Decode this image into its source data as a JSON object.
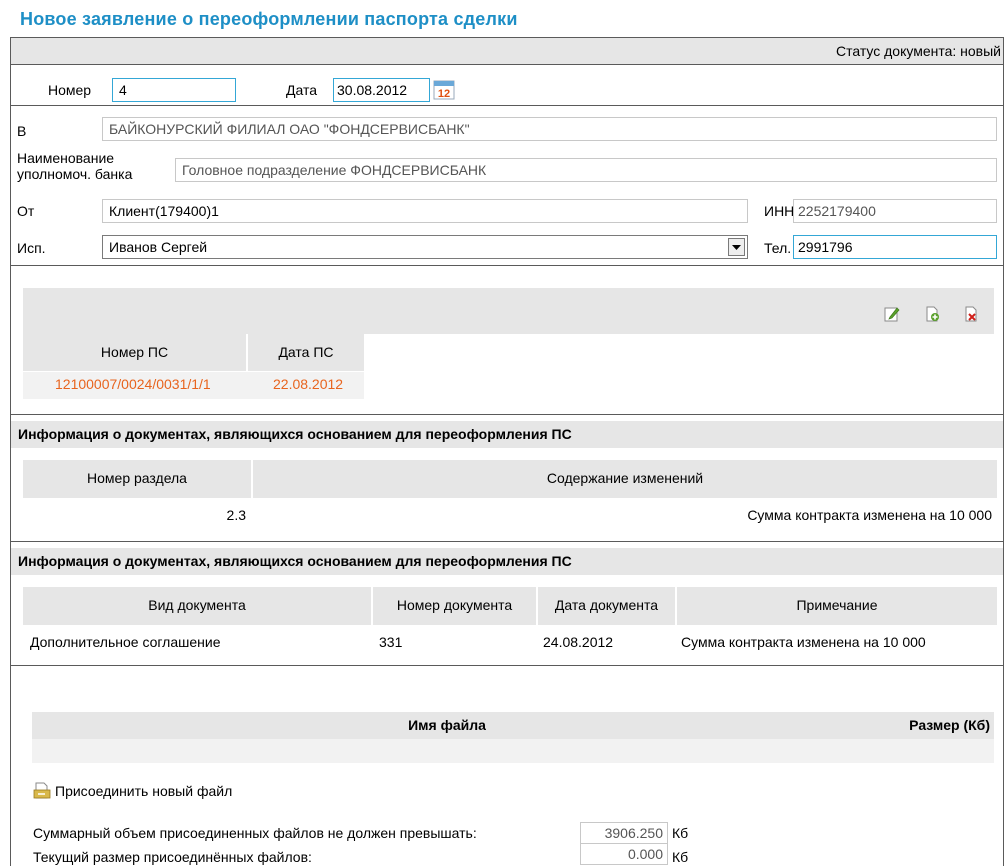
{
  "page": {
    "title": "Новое заявление о переоформлении паспорта сделки"
  },
  "status": {
    "text": "Статус документа: новый"
  },
  "header_fields": {
    "number_label": "Номер",
    "number_value": "4",
    "date_label": "Дата",
    "date_value": "30.08.2012",
    "calendar_icon_text": "12"
  },
  "bank": {
    "to_label": "В",
    "to_value": "БАЙКОНУРСКИЙ ФИЛИАЛ ОАО \"ФОНДСЕРВИСБАНК\"",
    "auth_bank_label_1": "Наименование",
    "auth_bank_label_2": "уполномоч. банка",
    "auth_bank_value": "Головное подразделение ФОНДСЕРВИСБАНК",
    "from_label": "От",
    "from_value": "Клиент(179400)1",
    "inn_label": "ИНН",
    "inn_value": "2252179400",
    "executor_label": "Исп.",
    "executor_value": "Иванов Сергей",
    "phone_label": "Тел.",
    "phone_value": "2991796"
  },
  "ps_table": {
    "headers": [
      "Номер ПС",
      "Дата ПС"
    ],
    "rows": [
      [
        "12100007/0024/0031/1/1",
        "22.08.2012"
      ]
    ]
  },
  "changes_section": {
    "title": "Информация о документах, являющихся основанием для переоформления ПС",
    "headers": [
      "Номер раздела",
      "Содержание изменений"
    ],
    "rows": [
      [
        "2.3",
        "Сумма контракта изменена на 10 000"
      ]
    ]
  },
  "docs_section": {
    "title": "Информация о документах, являющихся основанием для переоформления ПС",
    "headers": [
      "Вид документа",
      "Номер документа",
      "Дата документа",
      "Примечание"
    ],
    "rows": [
      [
        "Дополнительное соглашение",
        "331",
        "24.08.2012",
        "Сумма контракта изменена на 10 000"
      ]
    ]
  },
  "files": {
    "headers": [
      "Имя файла",
      "Размер (Кб)"
    ],
    "attach_label": "Присоединить новый файл",
    "limit_label": "Суммарный объем присоединенных файлов не должен превышать:",
    "limit_value": "3906.250",
    "current_label": "Текущий размер присоединённых файлов:",
    "current_value": "0.000",
    "unit": "Кб"
  },
  "colors": {
    "title": "#1e8fc6",
    "link_orange": "#e8641e",
    "band_gray": "#e6e6e6",
    "focus_blue": "#34a7d6"
  }
}
